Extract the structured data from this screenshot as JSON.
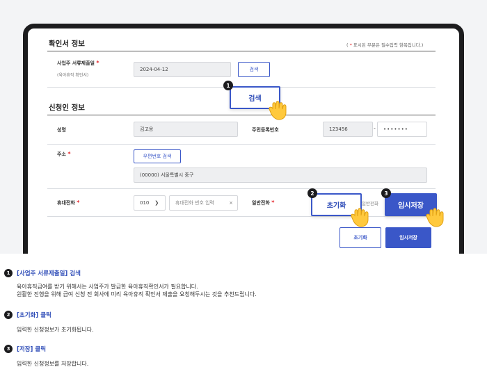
{
  "form": {
    "confirm_section_title": "확인서 정보",
    "required_note_pre": "( ",
    "required_star": "*",
    "required_note_post": " 표시된 부분은 필수입력 항목입니다.)",
    "employer_submit_label": "사업주 서류제출일",
    "employer_submit_sublabel": "(육아휴직 확인서)",
    "employer_submit_date": "2024-04-12",
    "search_button": "검색",
    "applicant_section_title": "신청인 정보",
    "name_label": "성명",
    "name_value": "김고용",
    "rrn_label": "주민등록번호",
    "rrn_front": "123456",
    "rrn_dash": "-",
    "rrn_back": "•••••••",
    "address_label": "주소",
    "zipcode_button": "우편번호 검색",
    "address_value": "(00000) 서울특별시 중구",
    "mobile_label": "휴대전화",
    "mobile_prefix": "010",
    "mobile_placeholder": "휴대전화 번호 입력",
    "clear_icon": "×",
    "landline_label": "일반전화",
    "landline_partial": "일반전화",
    "reset_button": "초기화",
    "temp_save_button": "임시저장",
    "colors": {
      "accent": "#3a57c8",
      "required": "#e5252a",
      "badge": "#1c1c1e"
    }
  },
  "callouts": {
    "c1": {
      "num": "1",
      "label": "검색"
    },
    "c2": {
      "num": "2",
      "label": "초기화"
    },
    "c3": {
      "num": "3",
      "label": "임시저장"
    }
  },
  "steps": [
    {
      "num": "1",
      "title": "[사업주 서류제출일] 검색",
      "body": [
        "육아휴직급여를 받기 위해서는 사업주가 발급한 육아휴직확인서가 필요합니다.",
        "원활한 진행을 위해 급여 신청 전 회사에 미리 육아휴직 확인서 제출을 요청해두시는 것을 추천드립니다."
      ]
    },
    {
      "num": "2",
      "title": "[초기화] 클릭",
      "body": [
        "입력한 신청정보가 초기화됩니다."
      ]
    },
    {
      "num": "3",
      "title": "[저장] 클릭",
      "body": [
        "입력한 신청정보를 저장합니다."
      ]
    }
  ]
}
